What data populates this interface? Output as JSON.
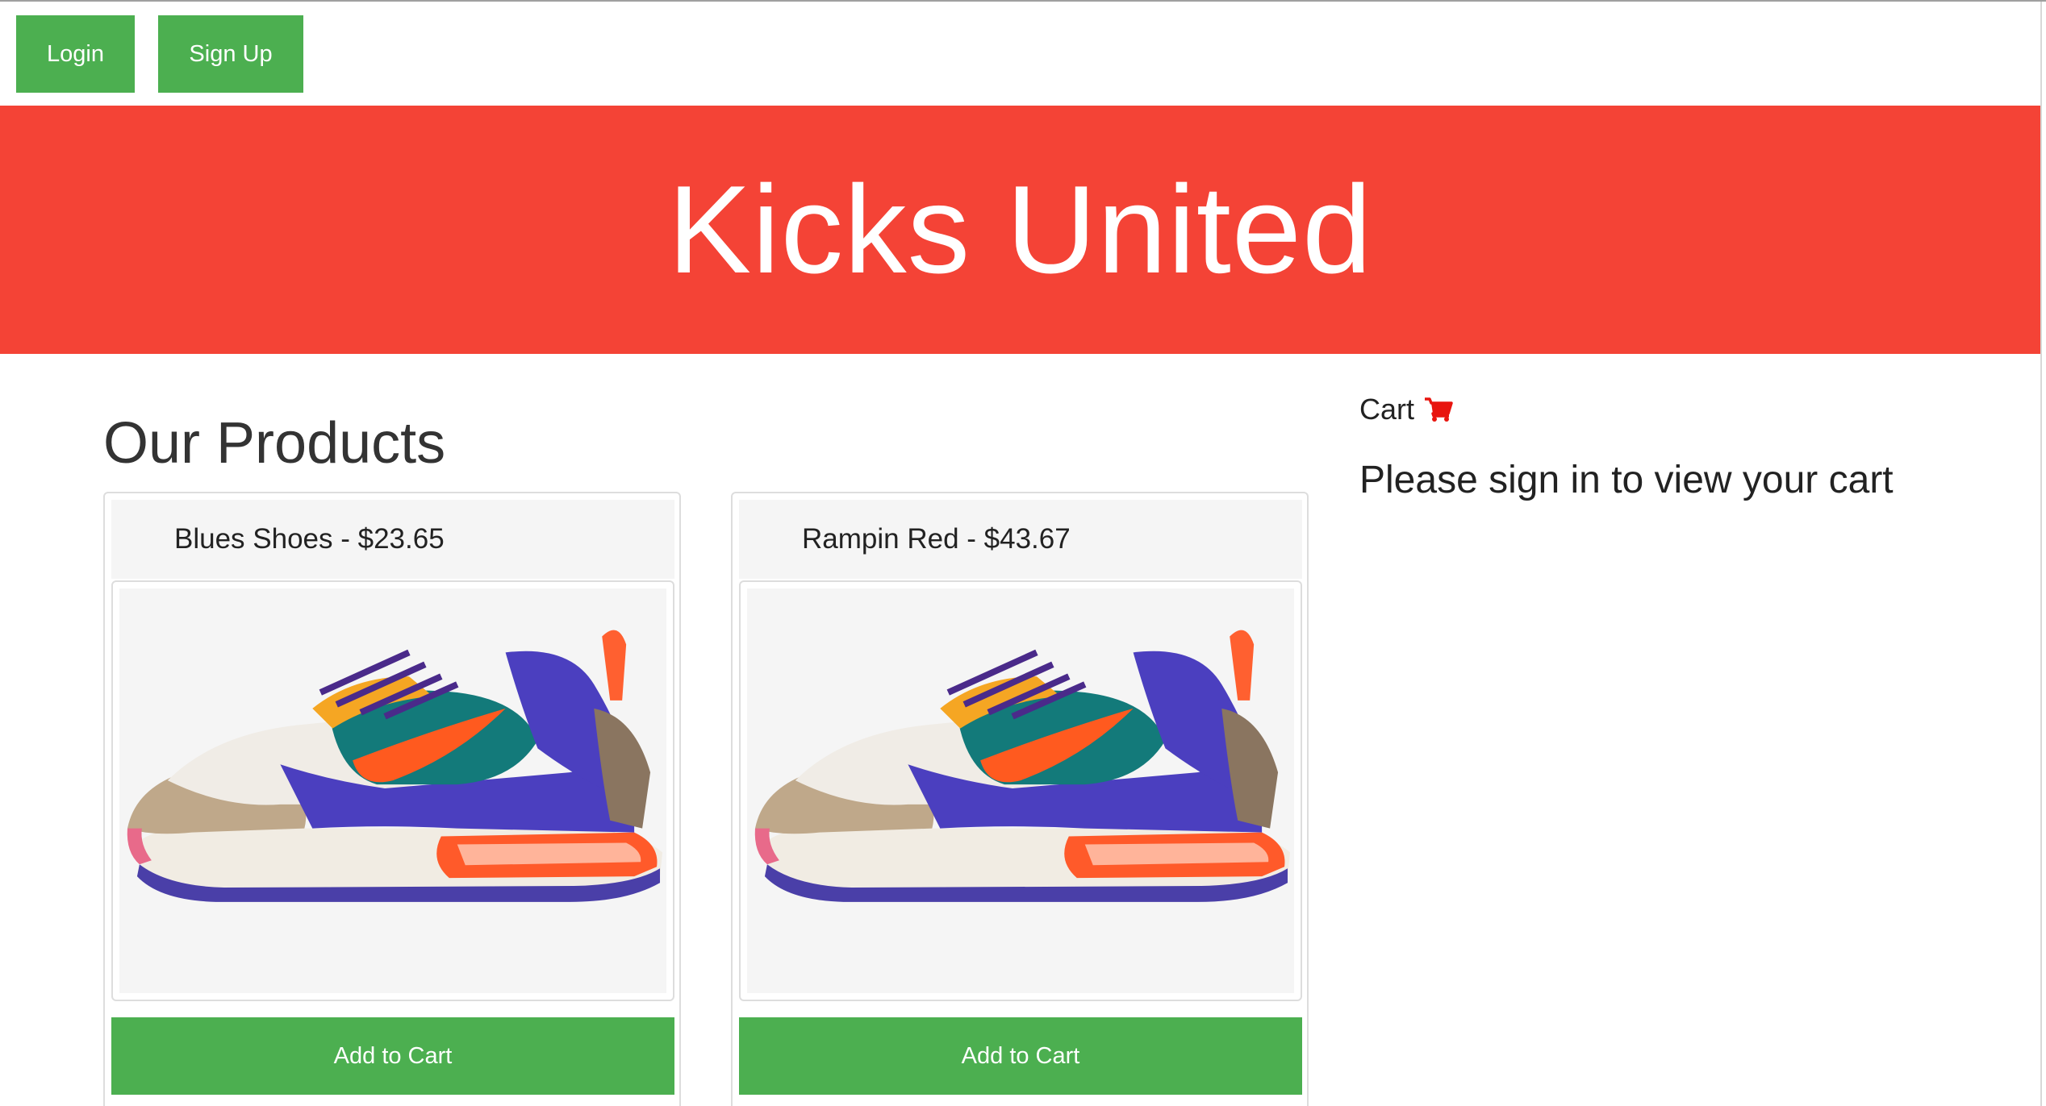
{
  "nav": {
    "login_label": "Login",
    "signup_label": "Sign Up"
  },
  "banner": {
    "title": "Kicks United"
  },
  "products": {
    "heading": "Our Products",
    "items": [
      {
        "title": "Blues Shoes - $23.65",
        "button_label": "Add to Cart",
        "image_icon": "sneaker-image"
      },
      {
        "title": "Rampin Red - $43.67",
        "button_label": "Add to Cart",
        "image_icon": "sneaker-image"
      }
    ]
  },
  "cart": {
    "label": "Cart",
    "icon": "shopping-cart-icon",
    "message": "Please sign in to view your cart"
  },
  "colors": {
    "accent_green": "#4caf50",
    "banner_red": "#f44336",
    "cart_icon_red": "#e8150f"
  }
}
